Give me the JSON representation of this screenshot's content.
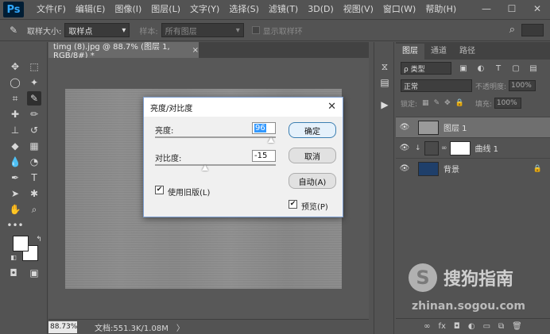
{
  "app": {
    "logo": "Ps",
    "menu": [
      "文件(F)",
      "编辑(E)",
      "图像(I)",
      "图层(L)",
      "文字(Y)",
      "选择(S)",
      "滤镜(T)",
      "3D(D)",
      "视图(V)",
      "窗口(W)",
      "帮助(H)"
    ],
    "window_buttons": [
      "—",
      "☐",
      "✕"
    ]
  },
  "options_bar": {
    "sample_size_label": "取样大小:",
    "sample_size_value": "取样点",
    "sample_label": "样本:",
    "sample_value": "所有图层",
    "show_ring_label": "显示取样环"
  },
  "document": {
    "tab_title": "timg (8).jpg @ 88.7% (图层 1, RGB/8#) *",
    "tab_close": "×",
    "zoom": "88.73%",
    "doc_info": "文档:551.3K/1.08M",
    "status_arrow": "〉"
  },
  "layers_panel": {
    "tabs": [
      "图层",
      "通道",
      "路径"
    ],
    "kind_filter": "ρ 类型",
    "blend_mode": "正常",
    "opacity_label": "不透明度:",
    "opacity_value": "100%",
    "lock_label": "锁定:",
    "fill_label": "填充:",
    "fill_value": "100%",
    "layers": [
      {
        "name": "图层 1",
        "selected": true
      },
      {
        "name": "曲线 1",
        "selected": false
      },
      {
        "name": "背景",
        "selected": false
      }
    ]
  },
  "dialog": {
    "title": "亮度/对比度",
    "brightness_label": "亮度:",
    "brightness_value": "96",
    "contrast_label": "对比度:",
    "contrast_value": "-15",
    "legacy_label": "使用旧版(L)",
    "legacy_checked": true,
    "ok_label": "确定",
    "cancel_label": "取消",
    "auto_label": "自动(A)",
    "preview_label": "预览(P)",
    "preview_checked": true
  },
  "watermark": {
    "brand": "搜狗指南",
    "url": "zhinan.sogou.com",
    "logo_letter": "S"
  }
}
